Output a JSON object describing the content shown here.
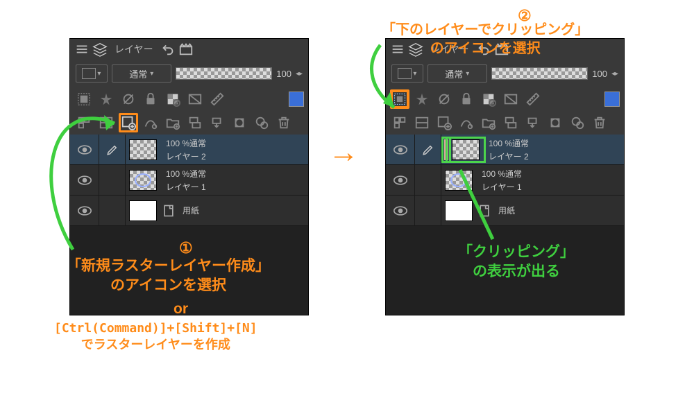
{
  "header": {
    "title": "レイヤー"
  },
  "options": {
    "blend_mode": "通常",
    "opacity_value": "100"
  },
  "layers": [
    {
      "blend": "100 %通常",
      "name": "レイヤー 2",
      "clipped": false
    },
    {
      "blend": "100 %通常",
      "name": "レイヤー 1",
      "clipped": false
    },
    {
      "blend": "",
      "name": "用紙",
      "clipped": false
    }
  ],
  "layers_right": [
    {
      "blend": "100 %通常",
      "name": "レイヤー 2",
      "clipped": true
    },
    {
      "blend": "100 %通常",
      "name": "レイヤー 1",
      "clipped": false
    },
    {
      "blend": "",
      "name": "用紙",
      "clipped": false
    }
  ],
  "arrow": "→",
  "annotations": {
    "step2_num": "②",
    "step2_text": "「下のレイヤーでクリッピング」\nのアイコンを選択",
    "step1_num": "①",
    "step1_text": "「新規ラスターレイヤー作成」\nのアイコンを選択",
    "or": "or",
    "keyboard": "[Ctrl(Command)]+[Shift]+[N]\nでラスターレイヤーを作成",
    "clip_result": "「クリッピング」\nの表示が出る"
  }
}
